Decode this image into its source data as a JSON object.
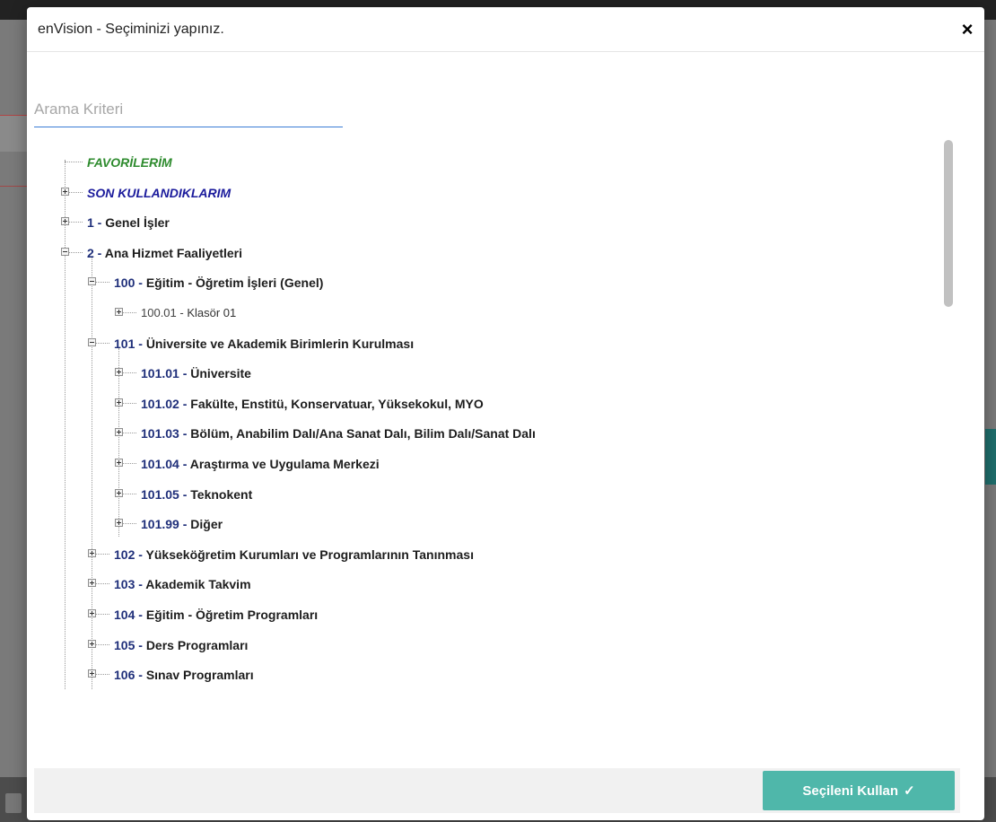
{
  "modal": {
    "title": "enVision - Seçiminizi yapınız.",
    "close_icon": "×"
  },
  "search": {
    "placeholder": "Arama Kriteri"
  },
  "tree": [
    {
      "code": "",
      "label": "FAVORİLERİM",
      "style": "fav",
      "level": 0,
      "expander": "none"
    },
    {
      "code": "",
      "label": "SON KULLANDIKLARIM",
      "style": "recent",
      "level": 0,
      "expander": "plus"
    },
    {
      "code": "1 - ",
      "label": "Genel İşler",
      "style": "bold",
      "level": 0,
      "expander": "plus"
    },
    {
      "code": "2 - ",
      "label": "Ana Hizmet Faaliyetleri",
      "style": "bold",
      "level": 0,
      "expander": "minus"
    },
    {
      "code": "100 - ",
      "label": "Eğitim - Öğretim İşleri (Genel)",
      "style": "bold",
      "level": 1,
      "expander": "minus"
    },
    {
      "code": "100.01 - ",
      "label": "Klasör 01",
      "style": "plain",
      "level": 2,
      "expander": "plus"
    },
    {
      "code": "101 - ",
      "label": "Üniversite ve Akademik Birimlerin Kurulması",
      "style": "bold",
      "level": 1,
      "expander": "minus"
    },
    {
      "code": "101.01 - ",
      "label": "Üniversite",
      "style": "bold",
      "level": 2,
      "expander": "plus"
    },
    {
      "code": "101.02 - ",
      "label": "Fakülte, Enstitü, Konservatuar, Yüksekokul, MYO",
      "style": "bold",
      "level": 2,
      "expander": "plus"
    },
    {
      "code": "101.03 - ",
      "label": "Bölüm, Anabilim Dalı/Ana Sanat Dalı, Bilim Dalı/Sanat Dalı",
      "style": "bold",
      "level": 2,
      "expander": "plus"
    },
    {
      "code": "101.04 - ",
      "label": "Araştırma ve Uygulama Merkezi",
      "style": "bold",
      "level": 2,
      "expander": "plus"
    },
    {
      "code": "101.05 - ",
      "label": "Teknokent",
      "style": "bold",
      "level": 2,
      "expander": "plus"
    },
    {
      "code": "101.99 - ",
      "label": "Diğer",
      "style": "bold",
      "level": 2,
      "expander": "plus"
    },
    {
      "code": "102 - ",
      "label": "Yükseköğretim Kurumları ve Programlarının Tanınması",
      "style": "bold",
      "level": 1,
      "expander": "plus"
    },
    {
      "code": "103 - ",
      "label": "Akademik Takvim",
      "style": "bold",
      "level": 1,
      "expander": "plus"
    },
    {
      "code": "104 - ",
      "label": "Eğitim - Öğretim Programları",
      "style": "bold",
      "level": 1,
      "expander": "plus"
    },
    {
      "code": "105 - ",
      "label": "Ders Programları",
      "style": "bold",
      "level": 1,
      "expander": "plus"
    },
    {
      "code": "106 - ",
      "label": "Sınav Programları",
      "style": "bold",
      "level": 1,
      "expander": "plus"
    }
  ],
  "footer": {
    "use_button_label": "Seçileni Kullan",
    "use_button_icon": "✓"
  },
  "colors": {
    "accent": "#4fb7aa",
    "favorites": "#2e8b2e",
    "recent": "#1b1b9c",
    "code": "#1f2f7a"
  }
}
